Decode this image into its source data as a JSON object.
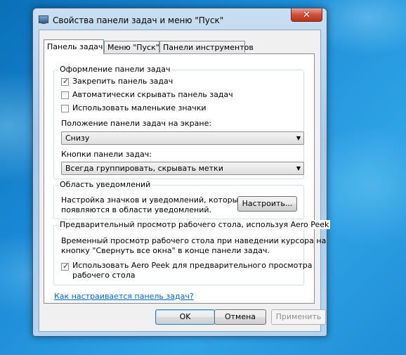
{
  "window": {
    "title": "Свойства панели задач и меню \"Пуск\"",
    "close_glyph": "✕"
  },
  "tabs": [
    {
      "label": "Панель задач",
      "active": true
    },
    {
      "label": "Меню \"Пуск\"",
      "active": false
    },
    {
      "label": "Панели инструментов",
      "active": false
    }
  ],
  "design_group": {
    "caption": "Оформление панели задач",
    "checkboxes": [
      {
        "label": "Закрепить панель задач",
        "checked": true
      },
      {
        "label": "Автоматически скрывать панель задач",
        "checked": false
      },
      {
        "label": "Использовать маленькие значки",
        "checked": false
      }
    ],
    "position_label": "Положение панели задач на экране:",
    "position_value": "Снизу",
    "buttons_label": "Кнопки панели задач:",
    "buttons_value": "Всегда группировать, скрывать метки"
  },
  "notification_group": {
    "caption": "Область уведомлений",
    "text_line1": "Настройка значков и уведомлений, которые",
    "text_line2": "появляются в области уведомлений.",
    "customize_button": "Настроить..."
  },
  "peek_group": {
    "caption": "Предварительный просмотр рабочего стола, используя Aero Peek",
    "text_line1": "Временный просмотр рабочего стола при наведении курсора на",
    "text_line2": "кнопку \"Свернуть все окна\" в конце панели задач.",
    "checkbox_line1": "Использовать Aero Peek для предварительного просмотра",
    "checkbox_line2": "рабочего стола",
    "checkbox_checked": true
  },
  "help_link": "Как настраивается панель задач?",
  "footer": {
    "ok": "OK",
    "cancel": "Отмена",
    "apply": "Применить"
  },
  "colors": {
    "desktop": "#1a8ad6",
    "link": "#0066cc",
    "close_button": "#c8452e"
  }
}
